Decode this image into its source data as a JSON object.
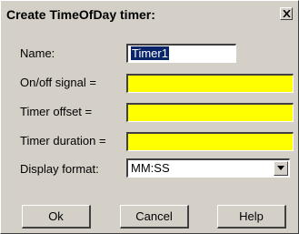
{
  "dialog": {
    "title": "Create TimeOfDay timer:",
    "close_icon": "close-icon"
  },
  "form": {
    "name_label": "Name:",
    "name_value": "Timer1",
    "onoff_label": "On/off signal =",
    "onoff_value": "",
    "offset_label": "Timer offset =",
    "offset_value": "",
    "duration_label": "Timer duration =",
    "duration_value": "",
    "display_label": "Display format:",
    "display_value": "MM:SS",
    "field_highlight_color": "#ffff00"
  },
  "buttons": {
    "ok": "Ok",
    "cancel": "Cancel",
    "help": "Help"
  }
}
